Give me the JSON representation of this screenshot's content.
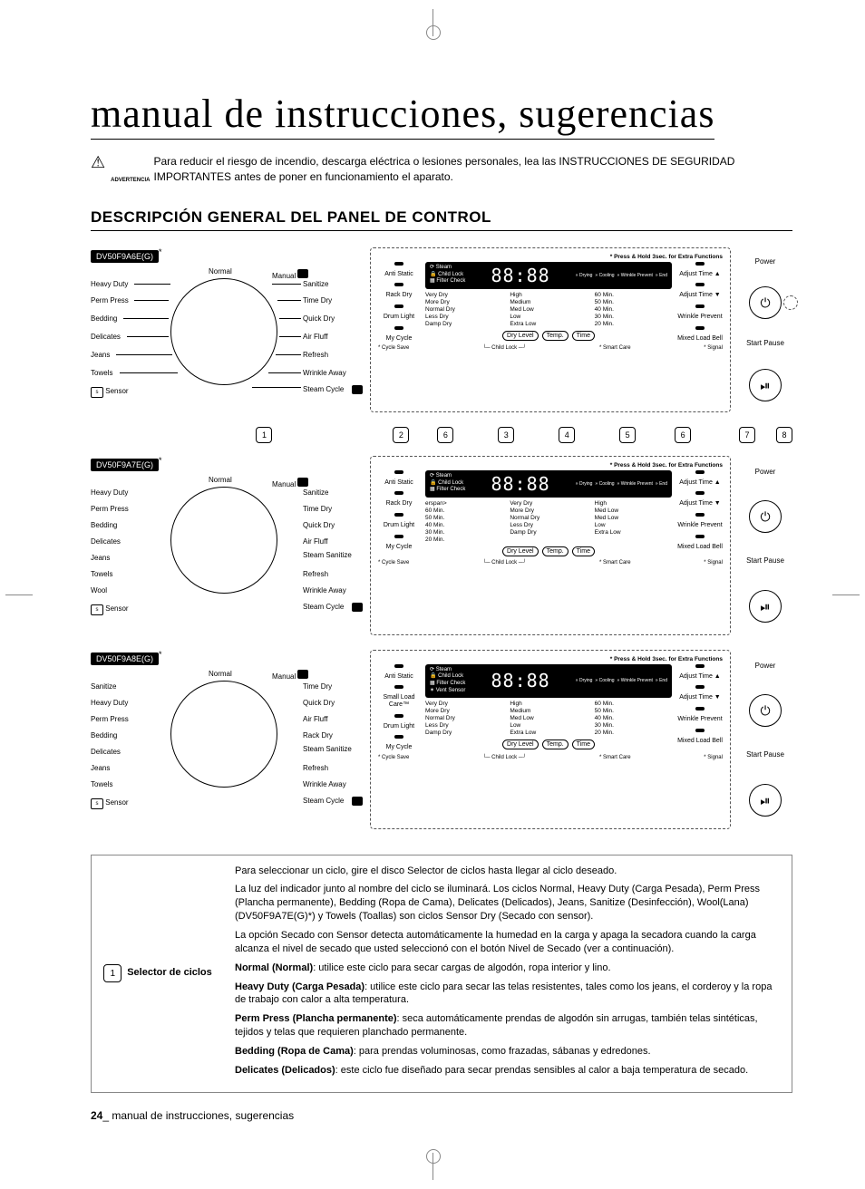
{
  "title": "manual de instrucciones, sugerencias",
  "warning_label": "ADVERTENCIA",
  "warning_text": "Para reducir el riesgo de incendio, descarga eléctrica o lesiones personales, lea las INSTRUCCIONES DE SEGURIDAD IMPORTANTES antes de poner en funcionamiento el aparato.",
  "section_title": "DESCRIPCIÓN GENERAL DEL PANEL DE CONTROL",
  "models": {
    "a": "DV50F9A6E(G)",
    "b": "DV50F9A7E(G)",
    "c": "DV50F9A8E(G)"
  },
  "dial_a": {
    "top": "Normal",
    "left": [
      "Heavy Duty",
      "Perm Press",
      "Bedding",
      "Delicates",
      "Jeans",
      "Towels"
    ],
    "right": [
      "Sanitize",
      "Time Dry",
      "Quick Dry",
      "Air Fluff",
      "Refresh",
      "Wrinkle Away",
      "Steam Cycle"
    ],
    "manual": "Manual",
    "sensor": "Sensor"
  },
  "dial_b": {
    "top": "Normal",
    "left": [
      "Heavy Duty",
      "Perm Press",
      "Bedding",
      "Delicates",
      "Jeans",
      "Towels",
      "Wool"
    ],
    "right": [
      "Sanitize",
      "Time Dry",
      "Quick Dry",
      "Air Fluff",
      "Steam Sanitize",
      "Refresh",
      "Wrinkle Away",
      "Steam Cycle"
    ],
    "manual": "Manual",
    "sensor": "Sensor"
  },
  "dial_c": {
    "top": "Normal",
    "left": [
      "Sanitize",
      "Heavy Duty",
      "Perm Press",
      "Bedding",
      "Delicates",
      "Jeans",
      "Towels"
    ],
    "right": [
      "Time Dry",
      "Quick Dry",
      "Air Fluff",
      "Rack Dry",
      "Steam Sanitize",
      "Refresh",
      "Wrinkle Away",
      "Steam Cycle"
    ],
    "manual": "Manual",
    "sensor": "Sensor"
  },
  "display": {
    "press_hold": "* Press & Hold 3sec. for Extra Functions",
    "left_btns_a": [
      "Anti Static",
      "Rack Dry",
      "Drum Light",
      "My Cycle"
    ],
    "left_btns_c": [
      "Anti Static",
      "Small Load Care™",
      "Drum Light",
      "My Cycle"
    ],
    "right_btns": [
      "Adjust Time ▲",
      "Adjust Time ▼",
      "Wrinkle Prevent",
      "Mixed Load Bell"
    ],
    "lcd_icons": [
      "Steam",
      "Child Lock",
      "Filter Check"
    ],
    "lcd_icons_c": [
      "Steam",
      "Child Lock",
      "Filter Check",
      "Vent Sensor"
    ],
    "digits": "88:88",
    "stages": [
      "Drying",
      "Cooling",
      "Wrinkle Prevent",
      "End"
    ],
    "table": {
      "c1": [
        "Very Dry",
        "More Dry",
        "Normal Dry",
        "Less Dry",
        "Damp Dry"
      ],
      "c2_a": [
        "High",
        "Medium",
        "Med Low",
        "Low",
        "Extra Low"
      ],
      "c2_b": [
        "High",
        "Med Low",
        "Med Low",
        "Low",
        "Extra Low"
      ],
      "c3": [
        "60 Min.",
        "50 Min.",
        "40 Min.",
        "30 Min.",
        "20 Min."
      ]
    },
    "pills": [
      "Dry Level",
      "Temp.",
      "Time"
    ],
    "foot": [
      "* Cycle Save",
      "Child Lock",
      "* Smart Care",
      "* Signal"
    ]
  },
  "power": "Power",
  "start_pause": "Start Pause",
  "callouts": [
    "1",
    "2",
    "6",
    "3",
    "4",
    "5",
    "6",
    "7",
    "8"
  ],
  "desc": {
    "num": "1",
    "label": "Selector de ciclos",
    "p1": "Para seleccionar un ciclo, gire el disco Selector de ciclos hasta llegar al ciclo deseado.",
    "p2": "La luz del indicador junto al nombre del ciclo se iluminará. Los ciclos Normal, Heavy Duty (Carga Pesada), Perm Press (Plancha permanente), Bedding (Ropa de Cama), Delicates (Delicados), Jeans, Sanitize (Desinfección), Wool(Lana) (DV50F9A7E(G)*) y Towels (Toallas) son ciclos Sensor Dry (Secado con sensor).",
    "p3": "La opción Secado con Sensor detecta automáticamente la humedad en la carga y apaga la secadora cuando la carga alcanza el nivel de secado que usted seleccionó con el botón Nivel de Secado (ver a continuación).",
    "p4a": "Normal (Normal)",
    "p4b": ": utilice este ciclo para secar cargas de algodón, ropa interior y lino.",
    "p5a": "Heavy Duty (Carga Pesada)",
    "p5b": ": utilice este ciclo para secar las telas resistentes, tales como los jeans, el corderoy y la ropa de trabajo con calor a alta temperatura.",
    "p6a": "Perm Press (Plancha permanente)",
    "p6b": ": seca automáticamente prendas de algodón sin arrugas, también telas sintéticas, tejidos y telas que requieren planchado permanente.",
    "p7a": "Bedding (Ropa de Cama)",
    "p7b": ": para prendas voluminosas, como frazadas, sábanas y edredones.",
    "p8a": "Delicates (Delicados)",
    "p8b": ": este ciclo fue diseñado para secar prendas sensibles al calor a baja temperatura de secado."
  },
  "footer_num": "24",
  "footer_text": "_ manual de instrucciones, sugerencias"
}
